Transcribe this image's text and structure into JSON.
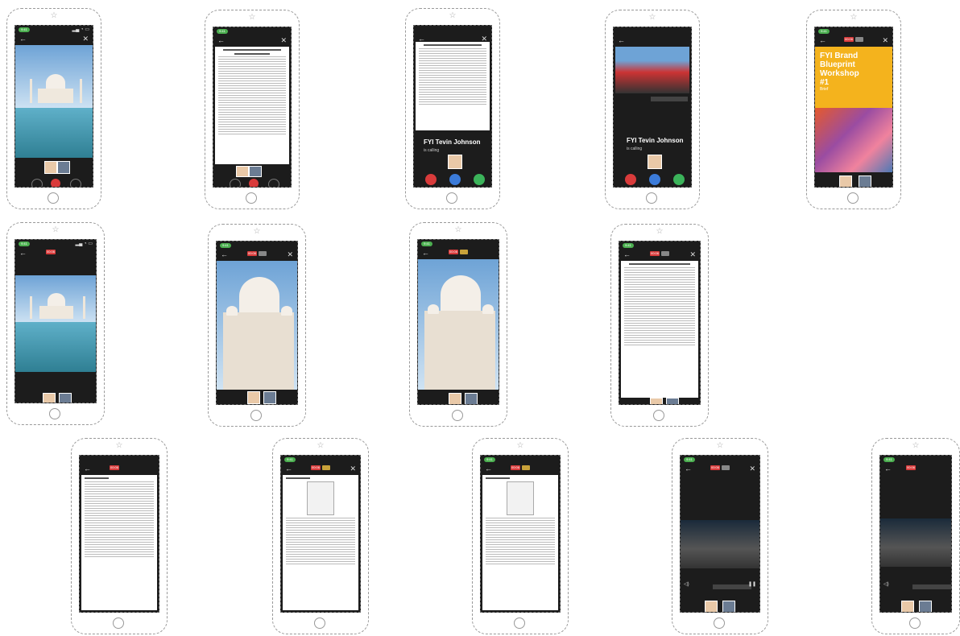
{
  "call": {
    "caller_name": "FYI Tevin Johnson",
    "caller_status": "is calling"
  },
  "recording": {
    "timer": "00:06",
    "label": "REC"
  },
  "poster": {
    "title": "FYI Brand Blueprint Workshop #1",
    "subtitle": "Brief"
  },
  "document": {
    "title": "Facility and Equipment Requirements for 'Tested Qualifying Environments'",
    "section_facility": "Facility Requirements",
    "section_space": "Space",
    "section_furniture": "Furniture",
    "section_technology": "Technology",
    "section_product": "Sample floor plan",
    "section_field": "Field Standards Needed",
    "section_basic": "The Basic Inventory Of Includes:",
    "section_shared": "The Shared Standards Includes:",
    "section_information": "Information Needed"
  },
  "status": {
    "time": "9:41"
  }
}
